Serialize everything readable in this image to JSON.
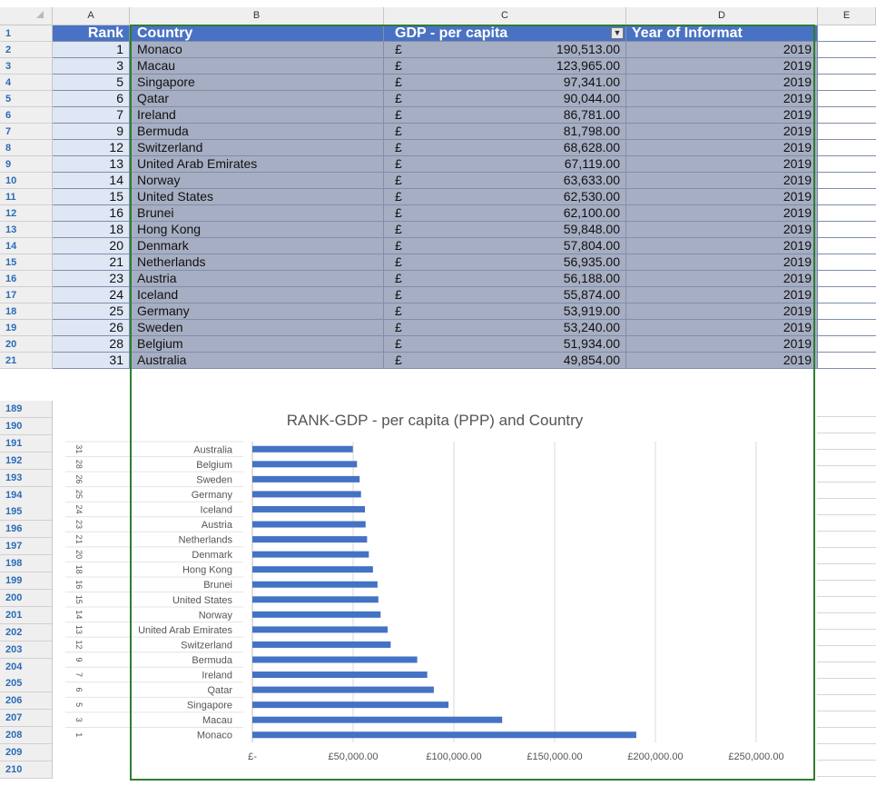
{
  "column_headers": [
    "A",
    "B",
    "C",
    "D",
    "E"
  ],
  "table": {
    "headers": {
      "rank": "Rank",
      "country": "Country",
      "gdp": "GDP - per capita",
      "year": "Year of Informat"
    },
    "currency_symbol": "£",
    "rows": [
      {
        "row_num": "2",
        "rank": "1",
        "country": "Monaco",
        "gdp": "190,513.00",
        "year": "2019"
      },
      {
        "row_num": "3",
        "rank": "3",
        "country": "Macau",
        "gdp": "123,965.00",
        "year": "2019"
      },
      {
        "row_num": "4",
        "rank": "5",
        "country": "Singapore",
        "gdp": "97,341.00",
        "year": "2019"
      },
      {
        "row_num": "5",
        "rank": "6",
        "country": "Qatar",
        "gdp": "90,044.00",
        "year": "2019"
      },
      {
        "row_num": "6",
        "rank": "7",
        "country": "Ireland",
        "gdp": "86,781.00",
        "year": "2019"
      },
      {
        "row_num": "7",
        "rank": "9",
        "country": "Bermuda",
        "gdp": "81,798.00",
        "year": "2019"
      },
      {
        "row_num": "8",
        "rank": "12",
        "country": "Switzerland",
        "gdp": "68,628.00",
        "year": "2019"
      },
      {
        "row_num": "9",
        "rank": "13",
        "country": "United Arab Emirates",
        "gdp": "67,119.00",
        "year": "2019"
      },
      {
        "row_num": "10",
        "rank": "14",
        "country": "Norway",
        "gdp": "63,633.00",
        "year": "2019"
      },
      {
        "row_num": "11",
        "rank": "15",
        "country": "United States",
        "gdp": "62,530.00",
        "year": "2019"
      },
      {
        "row_num": "12",
        "rank": "16",
        "country": "Brunei",
        "gdp": "62,100.00",
        "year": "2019"
      },
      {
        "row_num": "13",
        "rank": "18",
        "country": "Hong Kong",
        "gdp": "59,848.00",
        "year": "2019"
      },
      {
        "row_num": "14",
        "rank": "20",
        "country": "Denmark",
        "gdp": "57,804.00",
        "year": "2019"
      },
      {
        "row_num": "15",
        "rank": "21",
        "country": "Netherlands",
        "gdp": "56,935.00",
        "year": "2019"
      },
      {
        "row_num": "16",
        "rank": "23",
        "country": "Austria",
        "gdp": "56,188.00",
        "year": "2019"
      },
      {
        "row_num": "17",
        "rank": "24",
        "country": "Iceland",
        "gdp": "55,874.00",
        "year": "2019"
      },
      {
        "row_num": "18",
        "rank": "25",
        "country": "Germany",
        "gdp": "53,919.00",
        "year": "2019"
      },
      {
        "row_num": "19",
        "rank": "26",
        "country": "Sweden",
        "gdp": "53,240.00",
        "year": "2019"
      },
      {
        "row_num": "20",
        "rank": "28",
        "country": "Belgium",
        "gdp": "51,934.00",
        "year": "2019"
      },
      {
        "row_num": "21",
        "rank": "31",
        "country": "Australia",
        "gdp": "49,854.00",
        "year": "2019"
      }
    ]
  },
  "header_row_num": "1",
  "lower_row_nums": [
    "189",
    "190",
    "191",
    "192",
    "193",
    "194",
    "195",
    "196",
    "197",
    "198",
    "199",
    "200",
    "201",
    "202",
    "203",
    "204",
    "205",
    "206",
    "207",
    "208",
    "209",
    "210"
  ],
  "filter_icon": "filter-icon",
  "colors": {
    "header_blue": "#4a72c4",
    "bar_blue": "#4472c4",
    "selection_green": "#2e7d32"
  },
  "chart_data": {
    "type": "bar",
    "orientation": "horizontal",
    "title": "RANK-GDP - per capita (PPP) and Country",
    "categories": [
      "Monaco",
      "Macau",
      "Singapore",
      "Qatar",
      "Ireland",
      "Bermuda",
      "Switzerland",
      "United Arab Emirates",
      "Norway",
      "United States",
      "Brunei",
      "Hong Kong",
      "Denmark",
      "Netherlands",
      "Austria",
      "Iceland",
      "Germany",
      "Sweden",
      "Belgium",
      "Australia"
    ],
    "ranks": [
      "1",
      "3",
      "5",
      "6",
      "7",
      "9",
      "12",
      "13",
      "14",
      "15",
      "16",
      "18",
      "20",
      "21",
      "23",
      "24",
      "25",
      "26",
      "28",
      "31"
    ],
    "values": [
      190513,
      123965,
      97341,
      90044,
      86781,
      81798,
      68628,
      67119,
      63633,
      62530,
      62100,
      59848,
      57804,
      56935,
      56188,
      55874,
      53919,
      53240,
      51934,
      49854
    ],
    "x_tick_labels": [
      "£-",
      "£50,000.00",
      "£100,000.00",
      "£150,000.00",
      "£200,000.00",
      "£250,000.00"
    ],
    "xlim": [
      0,
      250000
    ],
    "grid": true,
    "legend": "none"
  }
}
